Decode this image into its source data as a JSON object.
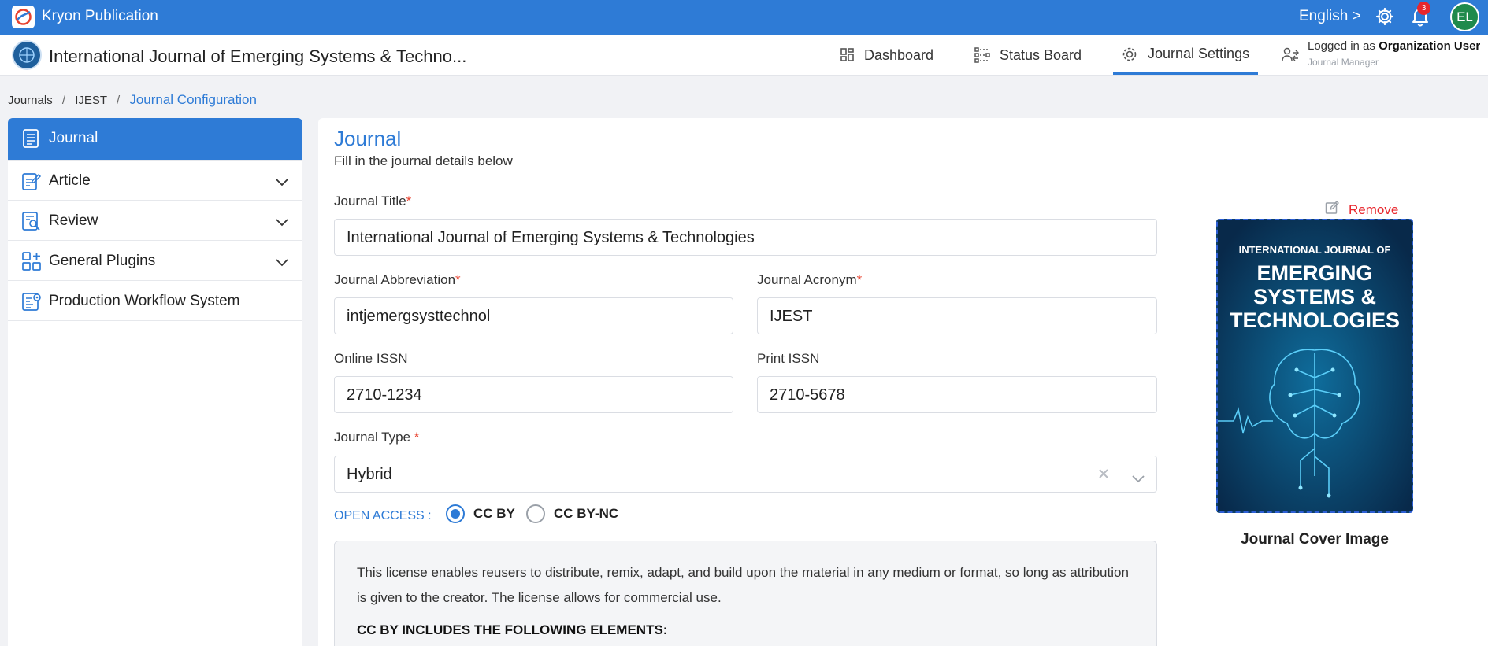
{
  "topbar": {
    "app_name": "Kryon Publication",
    "language": "English >",
    "notification_count": "3",
    "avatar_initials": "EL",
    "brand_color": "#2e7bd6"
  },
  "header": {
    "journal_title": "International Journal of Emerging Systems & Techno...",
    "nav": [
      {
        "label": "Dashboard",
        "icon": "dashboard-icon"
      },
      {
        "label": "Status Board",
        "icon": "status-board-icon"
      },
      {
        "label": "Journal Settings",
        "icon": "settings-gear-icon",
        "active": true
      }
    ],
    "logged_in_prefix": "Logged in as",
    "logged_in_user": "Organization User",
    "role": "Journal Manager"
  },
  "breadcrumb": {
    "items": [
      "Journals",
      "IJEST"
    ],
    "separator": "/",
    "current": "Journal Configuration"
  },
  "sidebar": {
    "items": [
      {
        "label": "Journal",
        "icon": "journal-icon",
        "active": true
      },
      {
        "label": "Article",
        "icon": "article-edit-icon",
        "expandable": true
      },
      {
        "label": "Review",
        "icon": "review-icon",
        "expandable": true
      },
      {
        "label": "General Plugins",
        "icon": "plugins-icon",
        "expandable": true
      },
      {
        "label": "Production Workflow System",
        "icon": "workflow-icon"
      }
    ]
  },
  "form": {
    "title": "Journal",
    "subtitle": "Fill in the journal details below",
    "journal_title_label": "Journal Title",
    "journal_title_value": "International Journal of Emerging Systems & Technologies",
    "abbreviation_label": "Journal Abbreviation",
    "abbreviation_value": "intjemergsysttechnol",
    "acronym_label": "Journal Acronym",
    "acronym_value": "IJEST",
    "online_issn_label": "Online ISSN",
    "online_issn_value": "2710-1234",
    "print_issn_label": "Print ISSN",
    "print_issn_value": "2710-5678",
    "type_label": "Journal Type",
    "type_value": "Hybrid",
    "required_mark": "*",
    "open_access_label": "OPEN ACCESS :",
    "license_options": [
      {
        "label": "CC BY",
        "selected": true
      },
      {
        "label": "CC BY-NC",
        "selected": false
      }
    ],
    "license_text": "This license enables reusers to distribute, remix, adapt, and build upon the material in any medium or format, so long as attribution is given to the creator. The license allows for commercial use.",
    "license_heading": "CC BY INCLUDES THE FOLLOWING ELEMENTS:"
  },
  "cover": {
    "remove_label": "Remove",
    "caption": "Journal Cover Image",
    "line1": "INTERNATIONAL JOURNAL OF",
    "line2": "EMERGING",
    "line3": "SYSTEMS &",
    "line4": "TECHNOLOGIES"
  }
}
